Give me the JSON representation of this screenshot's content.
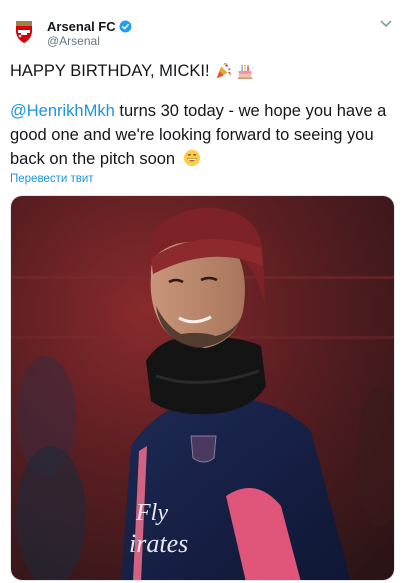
{
  "header": {
    "display_name": "Arsenal FC",
    "handle": "@Arsenal",
    "avatar_icon": "arsenal-crest-icon",
    "verified_icon": "verified-badge-icon",
    "menu_icon": "chevron-down-icon",
    "verified_color": "#1da1f2"
  },
  "tweet": {
    "line1": "HAPPY BIRTHDAY, MICKI!",
    "line1_emojis": [
      "party-popper-icon",
      "birthday-cake-icon"
    ],
    "mention": "@HenrikhMkh",
    "body": " turns 30 today - we hope you have a good one and we're looking forward to seeing you back on the pitch soon",
    "end_emoji": "grinning-face-icon",
    "translate_label": "Перевести твит",
    "link_color": "#1b95e0"
  },
  "media": {
    "image_icon": "player-photo",
    "shirt_text_line1": "Fly",
    "shirt_text_line2": "irates"
  }
}
